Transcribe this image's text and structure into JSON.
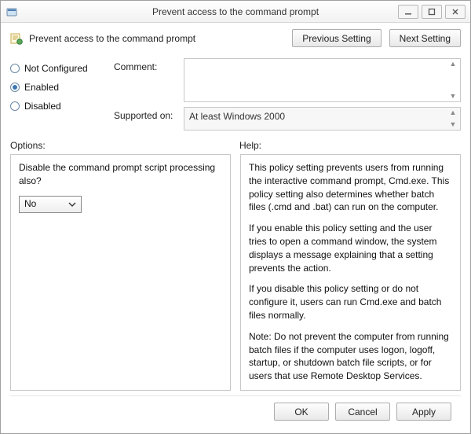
{
  "window": {
    "title": "Prevent access to the command prompt"
  },
  "header": {
    "heading": "Prevent access to the command prompt",
    "previous_btn": "Previous Setting",
    "next_btn": "Next Setting"
  },
  "state": {
    "not_configured": "Not Configured",
    "enabled": "Enabled",
    "disabled": "Disabled",
    "selected": "enabled"
  },
  "comment": {
    "label": "Comment:",
    "value": ""
  },
  "supported": {
    "label": "Supported on:",
    "value": "At least Windows 2000"
  },
  "sections": {
    "options_label": "Options:",
    "help_label": "Help:"
  },
  "options": {
    "question": "Disable the command prompt script processing also?",
    "select_value": "No"
  },
  "help": {
    "p1": "This policy setting prevents users from running the interactive command prompt, Cmd.exe.  This policy setting also determines whether batch files (.cmd and .bat) can run on the computer.",
    "p2": "If you enable this policy setting and the user tries to open a command window, the system displays a message explaining that a setting prevents the action.",
    "p3": "If you disable this policy setting or do not configure it, users can run Cmd.exe and batch files normally.",
    "p4": "Note: Do not prevent the computer from running batch files if the computer uses logon, logoff, startup, or shutdown batch file scripts, or for users that use Remote Desktop Services."
  },
  "footer": {
    "ok": "OK",
    "cancel": "Cancel",
    "apply": "Apply"
  }
}
